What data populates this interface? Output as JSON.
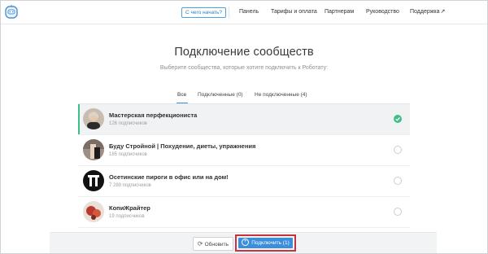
{
  "nav": {
    "start_button": "С чего начать?",
    "links": [
      "Панель",
      "Тарифы и оплата",
      "Партнерам",
      "Руководство",
      "Поддержка"
    ],
    "support_ext_icon": "↗"
  },
  "main": {
    "title": "Подключение сообществ",
    "subtitle": "Выберите сообщества, которые хотите подключить к Роботату:",
    "tabs": [
      {
        "label": "Все",
        "active": true
      },
      {
        "label": "Подключенные (0)",
        "active": false
      },
      {
        "label": "Не подключенные (4)",
        "active": false
      }
    ]
  },
  "groups": [
    {
      "name": "Мастерская перфекциониста",
      "subscribers": "126 подписчиков",
      "selected": true,
      "avatar": "portrait-photo"
    },
    {
      "name": "Буду Стройной | Похудение, диеты, упражнения",
      "subscribers": "185 подписчиков",
      "selected": false,
      "avatar": "fitness-photo"
    },
    {
      "name": "Осетинские пироги в офис или на дом!",
      "subscribers": "7 289 подписчиков",
      "selected": false,
      "avatar": "logo-mark"
    },
    {
      "name": "КопиЖрайтер",
      "subscribers": "19 подписчиков",
      "selected": false,
      "avatar": "food-photo"
    }
  ],
  "footer": {
    "refresh_label": "Обновить",
    "connect_label": "Подключить (1)"
  },
  "colors": {
    "accent_blue": "#3b8ed9",
    "accent_green": "#3fbf87",
    "highlight_red": "#c7343f"
  }
}
